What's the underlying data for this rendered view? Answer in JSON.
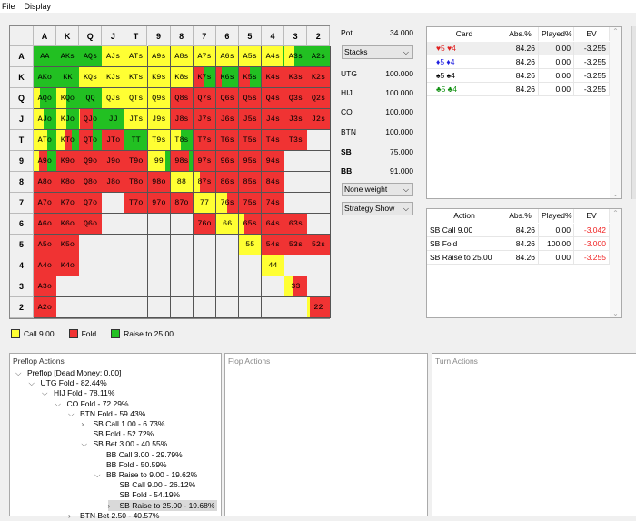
{
  "menu": [
    "File",
    "Display"
  ],
  "colors": {
    "call": "#ffff33",
    "fold": "#f03333",
    "raise": "#22c022"
  },
  "grid": {
    "ranks": [
      "A",
      "K",
      "Q",
      "J",
      "T",
      "9",
      "8",
      "7",
      "6",
      "5",
      "4",
      "3",
      "2"
    ],
    "selected": "54s",
    "rows": [
      [
        [
          "AA",
          0,
          0,
          1
        ],
        [
          "AKs",
          0,
          0,
          1
        ],
        [
          "AQs",
          0,
          0,
          1
        ],
        [
          "AJs",
          1,
          0,
          0
        ],
        [
          "ATs",
          1,
          0,
          0
        ],
        [
          "A9s",
          1,
          0,
          0
        ],
        [
          "A8s",
          1,
          0,
          0
        ],
        [
          "A7s",
          1,
          0,
          0
        ],
        [
          "A6s",
          1,
          0,
          0
        ],
        [
          "A5s",
          1,
          0,
          0
        ],
        [
          "A4s",
          0.97,
          0,
          0.03
        ],
        [
          "A3s",
          0.45,
          0,
          0.55
        ],
        [
          "A2s",
          0,
          0,
          1
        ]
      ],
      [
        [
          "AKo",
          0,
          0,
          1
        ],
        [
          "KK",
          0,
          0,
          1
        ],
        [
          "KQs",
          1,
          0,
          0
        ],
        [
          "KJs",
          1,
          0,
          0
        ],
        [
          "KTs",
          1,
          0,
          0
        ],
        [
          "K9s",
          1,
          0,
          0
        ],
        [
          "K8s",
          1,
          0,
          0
        ],
        [
          "K7s",
          0,
          0.45,
          0.55
        ],
        [
          "K6s",
          0,
          0.25,
          0.75
        ],
        [
          "K5s",
          0,
          0.5,
          0.5
        ],
        [
          "K4s",
          0,
          1,
          0
        ],
        [
          "K3s",
          0,
          1,
          0
        ],
        [
          "K2s",
          0,
          1,
          0
        ]
      ],
      [
        [
          "AQo",
          0.3,
          0,
          0.7
        ],
        [
          "KQo",
          0.45,
          0,
          0.55
        ],
        [
          "QQ",
          0,
          0,
          1
        ],
        [
          "QJs",
          1,
          0,
          0
        ],
        [
          "QTs",
          1,
          0,
          0
        ],
        [
          "Q9s",
          1,
          0,
          0
        ],
        [
          "Q8s",
          0,
          1,
          0
        ],
        [
          "Q7s",
          0,
          1,
          0
        ],
        [
          "Q6s",
          0,
          1,
          0
        ],
        [
          "Q5s",
          0,
          1,
          0
        ],
        [
          "Q4s",
          0,
          1,
          0
        ],
        [
          "Q3s",
          0,
          1,
          0
        ],
        [
          "Q2s",
          0,
          1,
          0
        ]
      ],
      [
        [
          "AJo",
          0.45,
          0,
          0.55
        ],
        [
          "KJo",
          0.45,
          0,
          0.55
        ],
        [
          "QJo",
          0.05,
          0.55,
          0.4
        ],
        [
          "JJ",
          0,
          0,
          1
        ],
        [
          "JTs",
          1,
          0,
          0
        ],
        [
          "J9s",
          1,
          0,
          0
        ],
        [
          "J8s",
          0,
          1,
          0
        ],
        [
          "J7s",
          0,
          1,
          0
        ],
        [
          "J6s",
          0,
          1,
          0
        ],
        [
          "J5s",
          0,
          1,
          0
        ],
        [
          "J4s",
          0,
          1,
          0
        ],
        [
          "J3s",
          0,
          1,
          0
        ],
        [
          "J2s",
          0,
          1,
          0
        ]
      ],
      [
        [
          "ATo",
          0.6,
          0,
          0.4
        ],
        [
          "KTo",
          0.4,
          0.3,
          0.3
        ],
        [
          "QTo",
          0,
          0.6,
          0.4
        ],
        [
          "JTo",
          0,
          1,
          0
        ],
        [
          "TT",
          0,
          0,
          1
        ],
        [
          "T9s",
          1,
          0,
          0
        ],
        [
          "T8s",
          0.45,
          0,
          0.55
        ],
        [
          "T7s",
          0,
          1,
          0
        ],
        [
          "T6s",
          0,
          1,
          0
        ],
        [
          "T5s",
          0,
          1,
          0
        ],
        [
          "T4s",
          0,
          1,
          0
        ],
        [
          "T3s",
          0,
          1,
          0
        ],
        null
      ],
      [
        [
          "A9o",
          0.25,
          0.35,
          0.4
        ],
        [
          "K9o",
          0,
          1,
          0
        ],
        [
          "Q9o",
          0,
          1,
          0
        ],
        [
          "J9o",
          0,
          1,
          0
        ],
        [
          "T9o",
          0,
          1,
          0
        ],
        [
          "99",
          0.8,
          0,
          0.2
        ],
        [
          "98s",
          0,
          0.85,
          0.15
        ],
        [
          "97s",
          0,
          1,
          0
        ],
        [
          "96s",
          0,
          1,
          0
        ],
        [
          "95s",
          0,
          1,
          0
        ],
        [
          "94s",
          0,
          1,
          0
        ],
        null,
        null
      ],
      [
        [
          "A8o",
          0,
          1,
          0
        ],
        [
          "K8o",
          0,
          1,
          0
        ],
        [
          "Q8o",
          0,
          1,
          0
        ],
        [
          "J8o",
          0,
          1,
          0
        ],
        [
          "T8o",
          0,
          1,
          0
        ],
        [
          "98o",
          0,
          1,
          0
        ],
        [
          "88",
          1,
          0,
          0
        ],
        [
          "87s",
          0.3,
          0.7,
          0
        ],
        [
          "86s",
          0,
          1,
          0
        ],
        [
          "85s",
          0,
          1,
          0
        ],
        [
          "84s",
          0,
          1,
          0
        ],
        null,
        null
      ],
      [
        [
          "A7o",
          0,
          1,
          0
        ],
        [
          "K7o",
          0,
          1,
          0
        ],
        [
          "Q7o",
          0,
          1,
          0
        ],
        null,
        [
          "T7o",
          0,
          1,
          0
        ],
        [
          "97o",
          0,
          1,
          0
        ],
        [
          "87o",
          0,
          1,
          0
        ],
        [
          "77",
          1,
          0,
          0
        ],
        [
          "76s",
          0.5,
          0.5,
          0
        ],
        [
          "75s",
          0,
          1,
          0
        ],
        [
          "74s",
          0,
          1,
          0
        ],
        null,
        null
      ],
      [
        [
          "A6o",
          0,
          1,
          0
        ],
        [
          "K6o",
          0,
          1,
          0
        ],
        [
          "Q6o",
          0,
          1,
          0
        ],
        null,
        null,
        null,
        null,
        [
          "76o",
          0,
          1,
          0
        ],
        [
          "66",
          1,
          0,
          0
        ],
        [
          "65s",
          0.25,
          0.75,
          0
        ],
        [
          "64s",
          0,
          1,
          0
        ],
        [
          "63s",
          0,
          1,
          0
        ],
        null
      ],
      [
        [
          "A5o",
          0,
          1,
          0
        ],
        [
          "K5o",
          0,
          1,
          0
        ],
        null,
        null,
        null,
        null,
        null,
        null,
        null,
        [
          "55",
          1,
          0,
          0
        ],
        [
          "54s",
          0,
          1,
          0
        ],
        [
          "53s",
          0,
          1,
          0
        ],
        [
          "52s",
          0,
          1,
          0
        ]
      ],
      [
        [
          "A4o",
          0,
          1,
          0
        ],
        [
          "K4o",
          0,
          1,
          0
        ],
        null,
        null,
        null,
        null,
        null,
        null,
        null,
        null,
        [
          "44",
          1,
          0,
          0
        ],
        null,
        null
      ],
      [
        [
          "A3o",
          0,
          1,
          0
        ],
        null,
        null,
        null,
        null,
        null,
        null,
        null,
        null,
        null,
        null,
        [
          "33",
          0.4,
          0.6,
          0
        ],
        null
      ],
      [
        [
          "A2o",
          0,
          1,
          0
        ],
        null,
        null,
        null,
        null,
        null,
        null,
        null,
        null,
        null,
        null,
        null,
        [
          "22",
          0.1,
          0.9,
          0
        ]
      ]
    ]
  },
  "legend": [
    {
      "label": "Call 9.00",
      "color": "#ffff33"
    },
    {
      "label": "Fold",
      "color": "#f03333"
    },
    {
      "label": "Raise to 25.00",
      "color": "#22c022"
    }
  ],
  "info": {
    "pot_label": "Pot",
    "pot": "34.000",
    "stacks_dropdown": "Stacks",
    "stacks": [
      {
        "pos": "UTG",
        "val": "100.000",
        "bold": false
      },
      {
        "pos": "HIJ",
        "val": "100.000",
        "bold": false
      },
      {
        "pos": "CO",
        "val": "100.000",
        "bold": false
      },
      {
        "pos": "BTN",
        "val": "100.000",
        "bold": false
      },
      {
        "pos": "SB",
        "val": "75.000",
        "bold": true
      },
      {
        "pos": "BB",
        "val": "91.000",
        "bold": true
      }
    ],
    "weight_dropdown": "None weight",
    "strategy_dropdown": "Strategy Show"
  },
  "card_table": {
    "headers": [
      "Card",
      "Abs.%",
      "Played%",
      "EV"
    ],
    "rows": [
      {
        "card": "♥5 ♥4",
        "color": "#e02020",
        "abs": "84.26",
        "played": "0.00",
        "ev": "-3.255"
      },
      {
        "card": "♦5 ♦4",
        "color": "#2020e0",
        "abs": "84.26",
        "played": "0.00",
        "ev": "-3.255"
      },
      {
        "card": "♠5 ♠4",
        "color": "#000000",
        "abs": "84.26",
        "played": "0.00",
        "ev": "-3.255"
      },
      {
        "card": "♣5 ♣4",
        "color": "#109010",
        "abs": "84.26",
        "played": "0.00",
        "ev": "-3.255"
      }
    ]
  },
  "action_table": {
    "headers": [
      "Action",
      "Abs.%",
      "Played%",
      "EV"
    ],
    "rows": [
      {
        "action": "SB Call 9.00",
        "abs": "84.26",
        "played": "0.00",
        "ev": "-3.042"
      },
      {
        "action": "SB Fold",
        "abs": "84.26",
        "played": "100.00",
        "ev": "-3.000"
      },
      {
        "action": "SB Raise to 25.00",
        "abs": "84.26",
        "played": "0.00",
        "ev": "-3.255"
      }
    ]
  },
  "preflop": {
    "title": "Preflop Actions",
    "nodes": [
      {
        "text": "Preflop [Dead Money: 0.00]",
        "depth": 0,
        "exp": "open"
      },
      {
        "text": "UTG Fold - 82.44%",
        "depth": 1,
        "exp": "open"
      },
      {
        "text": "HIJ Fold - 78.11%",
        "depth": 2,
        "exp": "open"
      },
      {
        "text": "CO Fold - 72.29%",
        "depth": 3,
        "exp": "open"
      },
      {
        "text": "BTN Fold - 59.43%",
        "depth": 4,
        "exp": "open"
      },
      {
        "text": "SB Call 1.00 - 6.73%",
        "depth": 5,
        "exp": "closed"
      },
      {
        "text": "SB Fold - 52.72%",
        "depth": 5,
        "exp": "none"
      },
      {
        "text": "SB Bet 3.00 - 40.55%",
        "depth": 5,
        "exp": "open"
      },
      {
        "text": "BB Call 3.00 - 29.79%",
        "depth": 6,
        "exp": "none"
      },
      {
        "text": "BB Fold - 50.59%",
        "depth": 6,
        "exp": "none"
      },
      {
        "text": "BB Raise to 9.00 - 19.62%",
        "depth": 6,
        "exp": "open"
      },
      {
        "text": "SB Call 9.00 - 26.12%",
        "depth": 7,
        "exp": "none"
      },
      {
        "text": "SB Fold - 54.19%",
        "depth": 7,
        "exp": "none"
      },
      {
        "text": "SB Raise to 25.00 - 19.68%",
        "depth": 7,
        "exp": "closed",
        "selected": true
      },
      {
        "text": "BTN Bet 2.50 - 40.57%",
        "depth": 4,
        "exp": "closed"
      }
    ]
  },
  "flop": {
    "title": "Flop Actions"
  },
  "turn": {
    "title": "Turn Actions"
  }
}
